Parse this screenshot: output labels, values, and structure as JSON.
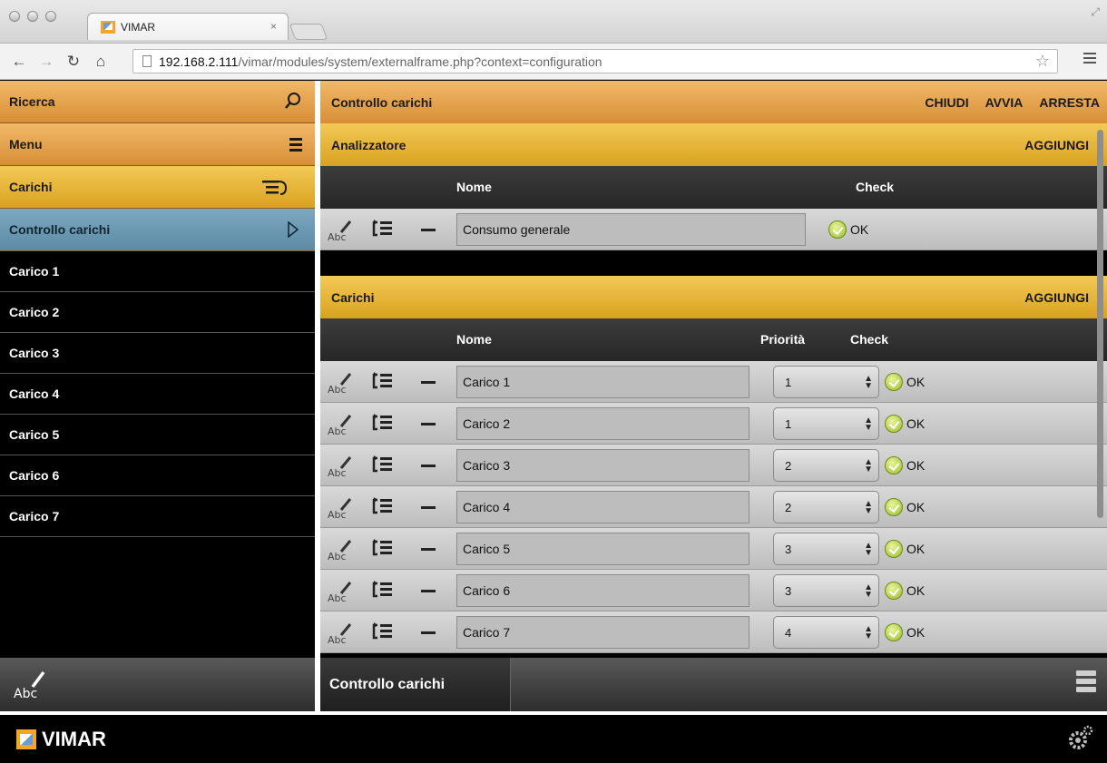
{
  "browser": {
    "tab_title": "VIMAR",
    "tab_close": "×",
    "url_host": "192.168.2.111",
    "url_path": "/vimar/modules/system/externalframe.php?context=configuration"
  },
  "sidebar": {
    "search_label": "Ricerca",
    "menu_label": "Menu",
    "section_label": "Carichi",
    "selected_item": "Controllo carichi",
    "items": [
      "Carico 1",
      "Carico 2",
      "Carico 3",
      "Carico 4",
      "Carico 5",
      "Carico 6",
      "Carico 7"
    ],
    "footer_icon_text": "Abc"
  },
  "main": {
    "title": "Controllo carichi",
    "actions": {
      "close": "CHIUDI",
      "start": "AVVIA",
      "stop": "ARRESTA"
    },
    "analyzer": {
      "title": "Analizzatore",
      "add": "AGGIUNGI",
      "col_name": "Nome",
      "col_check": "Check",
      "rows": [
        {
          "name": "Consumo generale",
          "check": "OK"
        }
      ]
    },
    "loads": {
      "title": "Carichi",
      "add": "AGGIUNGI",
      "col_name": "Nome",
      "col_priority": "Priorità",
      "col_check": "Check",
      "rows": [
        {
          "name": "Carico 1",
          "priority": "1",
          "check": "OK"
        },
        {
          "name": "Carico 2",
          "priority": "1",
          "check": "OK"
        },
        {
          "name": "Carico 3",
          "priority": "2",
          "check": "OK"
        },
        {
          "name": "Carico 4",
          "priority": "2",
          "check": "OK"
        },
        {
          "name": "Carico 5",
          "priority": "3",
          "check": "OK"
        },
        {
          "name": "Carico 6",
          "priority": "3",
          "check": "OK"
        },
        {
          "name": "Carico 7",
          "priority": "4",
          "check": "OK"
        }
      ]
    },
    "footer_tab": "Controllo carichi"
  },
  "footer": {
    "brand": "VIMAR"
  },
  "colors": {
    "orange": "#e3a04c",
    "yellow": "#e6b337",
    "blue": "#6c98b1",
    "ok_green": "#9cbc2c"
  }
}
